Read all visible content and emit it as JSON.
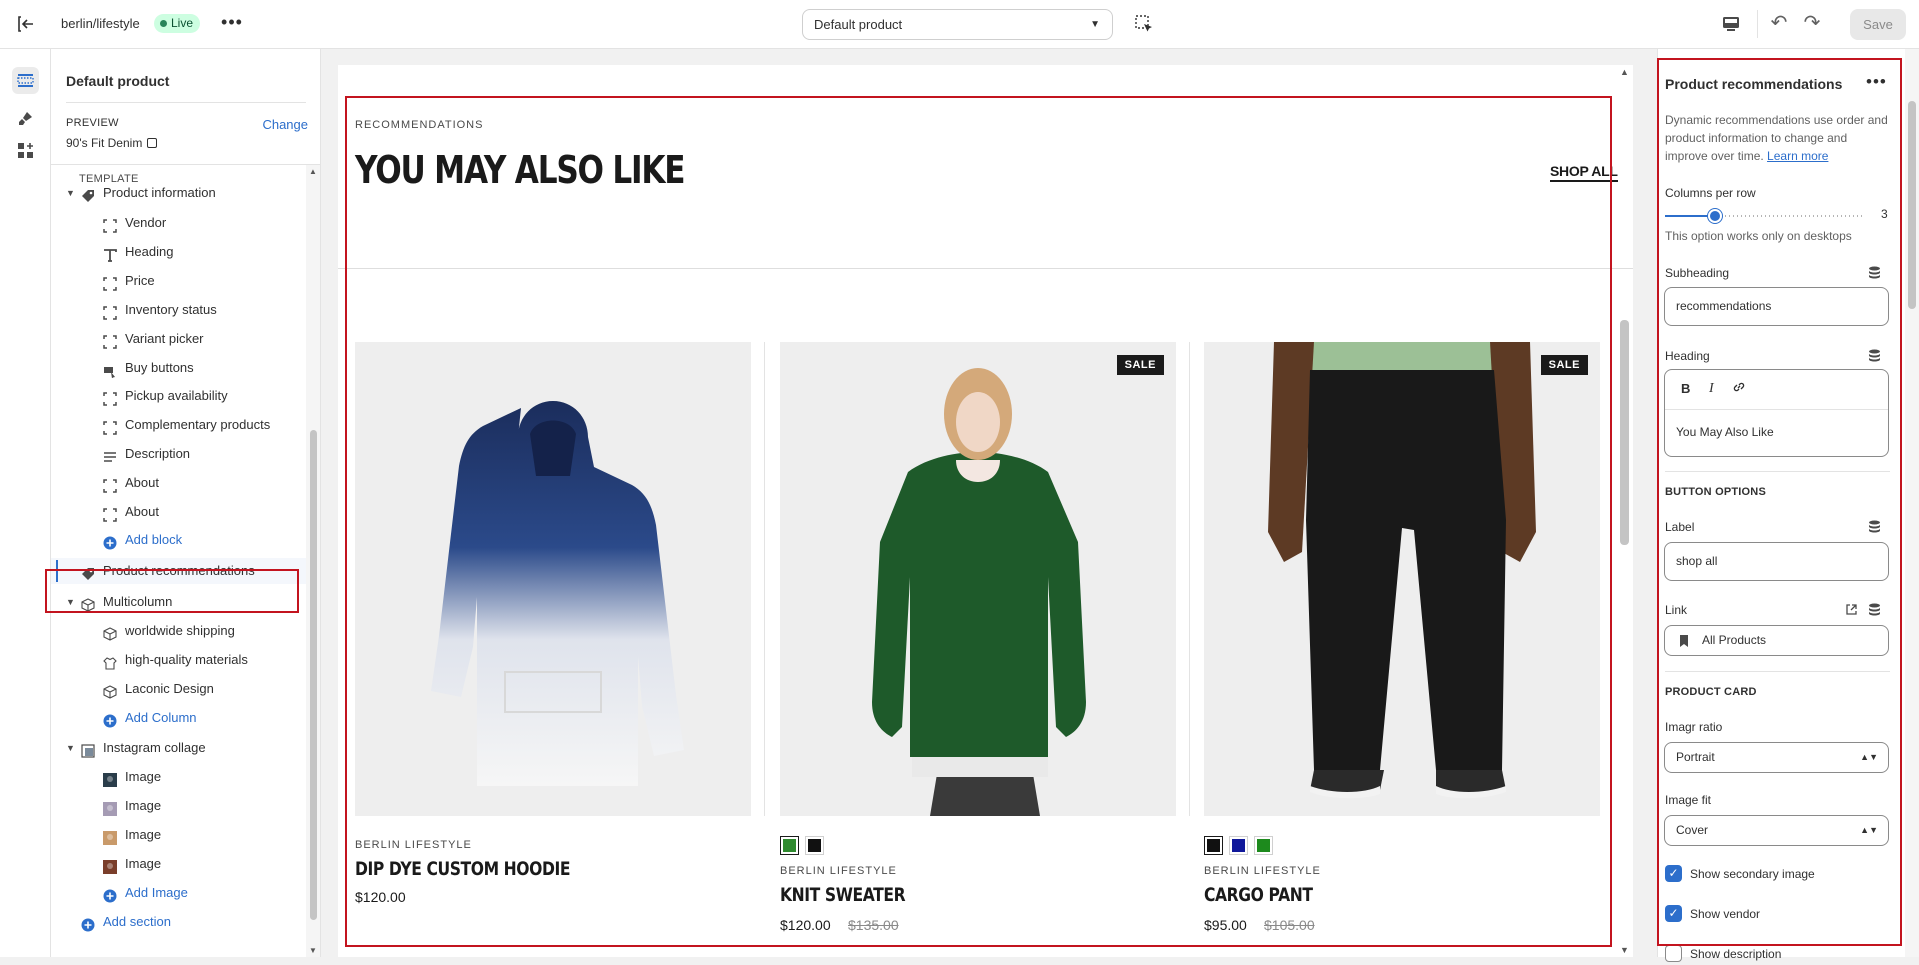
{
  "topbar": {
    "store": "berlin/lifestyle",
    "live": "Live",
    "template_select": "Default product",
    "save": "Save"
  },
  "left": {
    "title": "Default product",
    "preview_label": "PREVIEW",
    "change": "Change",
    "preview_product": "90's Fit Denim",
    "template_label": "TEMPLATE",
    "tree": [
      {
        "label": "Product information",
        "type": "section"
      },
      {
        "label": "Vendor",
        "type": "block"
      },
      {
        "label": "Heading",
        "type": "block"
      },
      {
        "label": "Price",
        "type": "block"
      },
      {
        "label": "Inventory status",
        "type": "block"
      },
      {
        "label": "Variant picker",
        "type": "block"
      },
      {
        "label": "Buy buttons",
        "type": "block"
      },
      {
        "label": "Pickup availability",
        "type": "block"
      },
      {
        "label": "Complementary products",
        "type": "block"
      },
      {
        "label": "Description",
        "type": "block"
      },
      {
        "label": "About",
        "type": "block"
      },
      {
        "label": "About",
        "type": "block"
      },
      {
        "label": "Add block",
        "type": "add"
      },
      {
        "label": "Product recommendations",
        "type": "section-selected"
      },
      {
        "label": "Multicolumn",
        "type": "section"
      },
      {
        "label": "worldwide shipping",
        "type": "block"
      },
      {
        "label": "high-quality materials",
        "type": "block"
      },
      {
        "label": "Laconic Design",
        "type": "block"
      },
      {
        "label": "Add Column",
        "type": "add"
      },
      {
        "label": "Instagram collage",
        "type": "section"
      },
      {
        "label": "Image",
        "type": "block"
      },
      {
        "label": "Image",
        "type": "block"
      },
      {
        "label": "Image",
        "type": "block"
      },
      {
        "label": "Image",
        "type": "block"
      },
      {
        "label": "Add Image",
        "type": "add"
      },
      {
        "label": "Add section",
        "type": "add-section"
      }
    ]
  },
  "preview": {
    "subheading": "RECOMMENDATIONS",
    "heading": "YOU MAY ALSO LIKE",
    "shop_all": "SHOP ALL",
    "products": [
      {
        "vendor": "BERLIN LIFESTYLE",
        "name": "DIP DYE CUSTOM HOODIE",
        "price": "$120.00",
        "compare": "",
        "sale": "",
        "swatches": []
      },
      {
        "vendor": "BERLIN LIFESTYLE",
        "name": "KNIT SWEATER",
        "price": "$120.00",
        "compare": "$135.00",
        "sale": "SALE",
        "swatches": [
          "#2f8a2f",
          "#111111"
        ]
      },
      {
        "vendor": "BERLIN LIFESTYLE",
        "name": "CARGO PANT",
        "price": "$95.00",
        "compare": "$105.00",
        "sale": "SALE",
        "swatches": [
          "#111111",
          "#10189a",
          "#1d8a1d"
        ]
      }
    ]
  },
  "right": {
    "title": "Product recommendations",
    "desc": "Dynamic recommendations use order and product information to change and improve over time.",
    "learn_more": "Learn more",
    "columns_label": "Columns per row",
    "columns_value": "3",
    "columns_fraction": 0.25,
    "columns_help": "This option works only on desktops",
    "subheading_label": "Subheading",
    "subheading_value": "recommendations",
    "heading_label": "Heading",
    "heading_value": "You May Also Like",
    "editor_bold": "B",
    "editor_italic": "I",
    "button_options": "BUTTON OPTIONS",
    "label_label": "Label",
    "label_value": "shop all",
    "link_label": "Link",
    "link_value": "All Products",
    "product_card": "PRODUCT CARD",
    "ratio_label": "Imagr ratio",
    "ratio_value": "Portrait",
    "fit_label": "Image fit",
    "fit_value": "Cover",
    "check_secondary": "Show secondary image",
    "check_vendor": "Show vendor",
    "check_description": "Show description"
  }
}
